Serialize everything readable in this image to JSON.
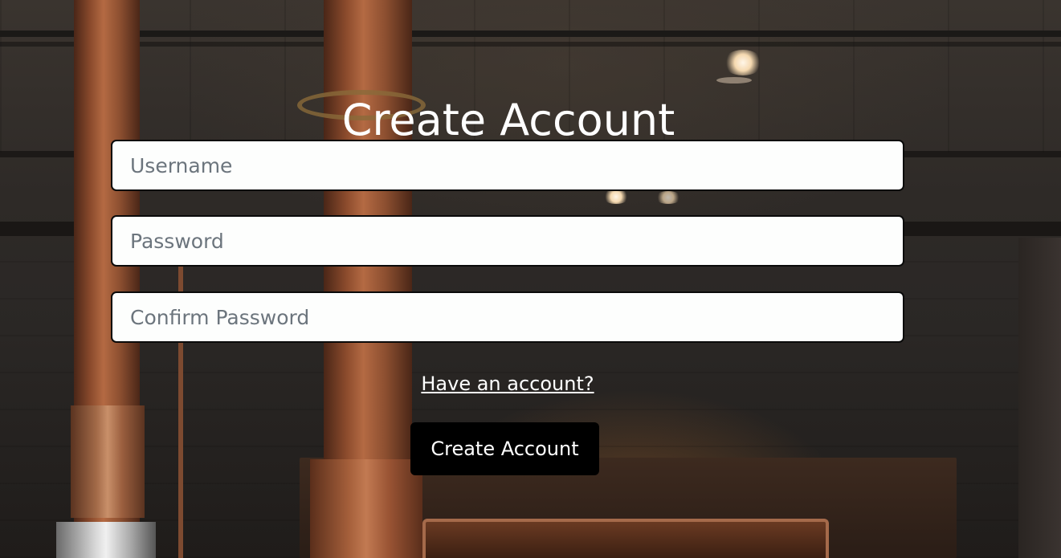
{
  "page": {
    "title": "Create Account"
  },
  "form": {
    "username": {
      "placeholder": "Username",
      "value": ""
    },
    "password": {
      "placeholder": "Password",
      "value": ""
    },
    "confirm_password": {
      "placeholder": "Confirm Password",
      "value": ""
    },
    "login_link_text": "Have an account?",
    "submit_label": "Create Account"
  },
  "colors": {
    "title_text": "#ffffff",
    "button_bg": "#000000",
    "button_text": "#ffffff",
    "input_bg": "#fdfefd",
    "input_border": "#0a0a0a",
    "placeholder_text": "#6c757d"
  },
  "background": {
    "description_icon": "brewery-interior-background-image"
  }
}
